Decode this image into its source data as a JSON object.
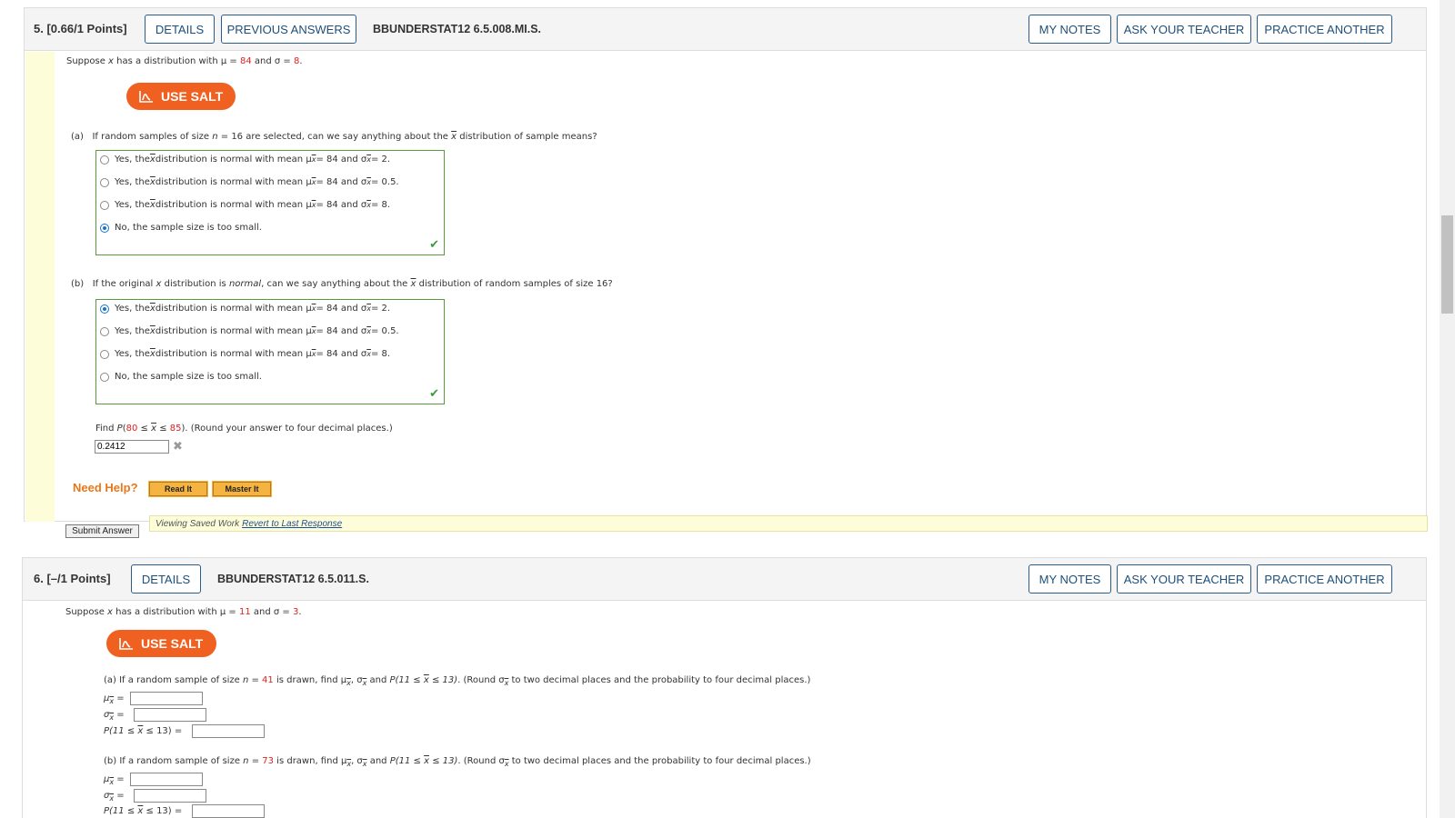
{
  "q5": {
    "number": "5.",
    "points": "[0.66/1 Points]",
    "details": "DETAILS",
    "previous_answers": "PREVIOUS ANSWERS",
    "code": "BBUNDERSTAT12 6.5.008.MI.S.",
    "my_notes": "MY NOTES",
    "ask_teacher": "ASK YOUR TEACHER",
    "practice_another": "PRACTICE ANOTHER",
    "intro_pre": "Suppose ",
    "intro_x": "x",
    "intro_mid1": " has a distribution with μ = ",
    "intro_mu": "84",
    "intro_mid2": " and σ = ",
    "intro_sigma": "8",
    "intro_end": ".",
    "use_salt": "USE SALT",
    "part_a": {
      "label": "(a)",
      "question_pre": "If random samples of size ",
      "n_var": "n",
      "question_mid": " = 16 are selected, can we say anything about the ",
      "xbar": "x",
      "question_end": " distribution of sample means?"
    },
    "part_b": {
      "label": "(b)",
      "question_pre": "If the original ",
      "x_var": "x",
      "question_mid": " distribution is ",
      "normal": "normal",
      "question_mid2": ", can we say anything about the ",
      "xbar": "x",
      "question_end": " distribution of random samples of size 16?"
    },
    "options": [
      {
        "pre": "Yes, the ",
        "post": " distribution is normal with mean μ",
        "mid": " = 84 and σ",
        "end": " = 2."
      },
      {
        "pre": "Yes, the ",
        "post": " distribution is normal with mean μ",
        "mid": " = 84 and σ",
        "end": " = 0.5."
      },
      {
        "pre": "Yes, the ",
        "post": " distribution is normal with mean μ",
        "mid": " = 84 and σ",
        "end": " = 8."
      },
      {
        "text": "No, the sample size is too small."
      }
    ],
    "selected_a": 3,
    "selected_b": 0,
    "find_pre": "Find ",
    "find_p": "P",
    "find_open": "(",
    "find_lo": "80",
    "find_le1": " ≤ ",
    "find_x": "x",
    "find_le2": " ≤ ",
    "find_hi": "85",
    "find_close": ")",
    "find_note": ". (Round your answer to four decimal places.)",
    "answer_value": "0.2412",
    "need_help": "Need Help?",
    "read_it": "Read It",
    "master_it": "Master It",
    "submit": "Submit Answer",
    "viewing_saved": "Viewing Saved Work",
    "revert": "Revert to Last Response"
  },
  "q6": {
    "number": "6.",
    "points": "[–/1 Points]",
    "details": "DETAILS",
    "code": "BBUNDERSTAT12 6.5.011.S.",
    "my_notes": "MY NOTES",
    "ask_teacher": "ASK YOUR TEACHER",
    "practice_another": "PRACTICE ANOTHER",
    "intro_pre": "Suppose ",
    "intro_x": "x",
    "intro_mid1": " has a distribution with μ = ",
    "intro_mu": "11",
    "intro_mid2": " and σ = ",
    "intro_sigma": "3",
    "intro_end": ".",
    "use_salt": "USE SALT",
    "part_a": {
      "pre": "(a) If a random sample of size ",
      "n_var": "n",
      "eq": " = ",
      "n_val": "41",
      "mid": " is drawn, find μ",
      "mid2": ", σ",
      "mid3": " and ",
      "p_expr": "P(11 ≤ ",
      "p_end": " ≤ 13)",
      "round": ". (Round σ",
      "round_end": " to two decimal places and the probability to four decimal places.)"
    },
    "part_b": {
      "pre": "(b) If a random sample of size ",
      "n_var": "n",
      "eq": " = ",
      "n_val": "73",
      "mid": " is drawn, find μ",
      "mid2": ", σ",
      "mid3": " and ",
      "p_expr": "P(11 ≤ ",
      "p_end": " ≤ 13)",
      "round": ". (Round σ",
      "round_end": " to two decimal places and the probability to four decimal places.)"
    },
    "mu_label": "μ",
    "sigma_label": "σ",
    "equals": " =",
    "p_label_pre": "P(11 ≤ ",
    "p_label_post": " ≤ 13) =",
    "sub_x": "x"
  }
}
